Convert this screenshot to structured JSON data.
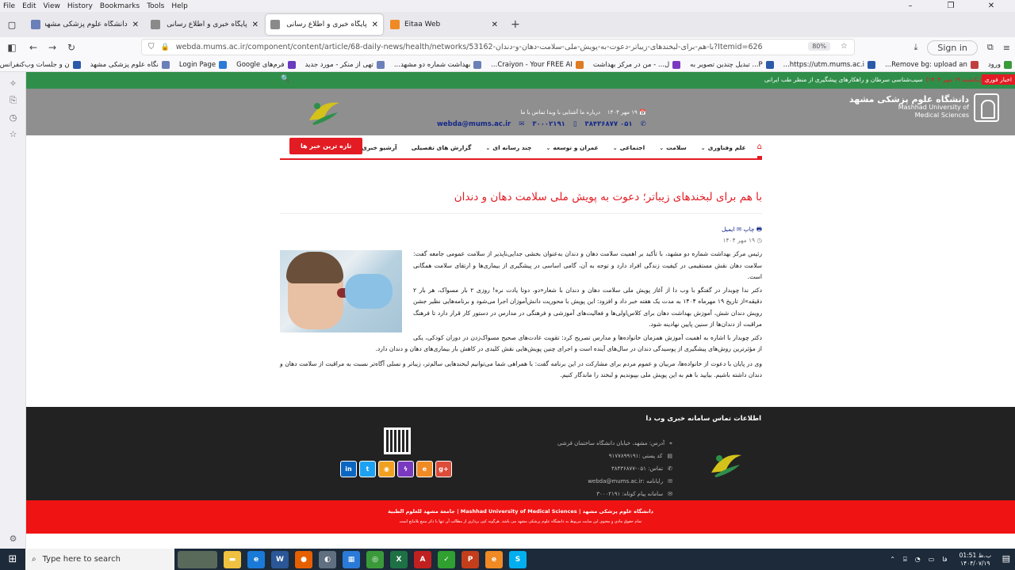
{
  "menubar": {
    "items": [
      "File",
      "Edit",
      "View",
      "History",
      "Bookmarks",
      "Tools",
      "Help"
    ]
  },
  "tabs": [
    {
      "label": "دانشگاه علوم پزشکی مشهد - دا...",
      "color": "#6b7fb8",
      "active": false
    },
    {
      "label": "پایگاه خبری و اطلاع رسانی وبدا دا...",
      "color": "#8a8a8a",
      "active": false
    },
    {
      "label": "پایگاه خبری و اطلاع رسانی وب دا...",
      "color": "#8a8a8a",
      "active": true
    },
    {
      "label": "Eitaa Web",
      "color": "#f08a24",
      "active": false
    }
  ],
  "address": {
    "url": "webda.mums.ac.ir/component/content/article/68-daily-news/health/networks/53162-با-هم-برای-لبخندهای-زیباتر-دعوت-به-پویش-ملی-سلامت-دهان-و-دندان?Itemid=626",
    "zoom": "80%",
    "signin": "Sign in"
  },
  "bookmarks": [
    {
      "label": "ورود",
      "color": "#3a9a3a"
    },
    {
      "label": "Remove bg: upload an...",
      "color": "#c04040"
    },
    {
      "label": "https://utm.mums.ac.i...",
      "color": "#2a5aa8"
    },
    {
      "label": "P... تبدیل چندین تصویر به",
      "color": "#2a5aa8"
    },
    {
      "label": "ل... - من در مرکز بهداشت",
      "color": "#7a3ac0"
    },
    {
      "label": "Craiyon - Your FREE AI...",
      "color": "#e07a20"
    },
    {
      "label": "بهداشت شماره دو مشهد...",
      "color": "#6b7fb8"
    },
    {
      "label": "تهی از منکر - مورد جدید",
      "color": "#6b7fb8"
    },
    {
      "label": "فرم‌های Google",
      "color": "#6a3ac0"
    },
    {
      "label": "Login Page",
      "color": "#2a7ad8"
    },
    {
      "label": "نگاه علوم پزشکی مشهد",
      "color": "#6b7fb8"
    },
    {
      "label": "ن و جلسات وب‌کنفرانس",
      "color": "#2a5aa8"
    }
  ],
  "newsbar": {
    "tag": "اخبار فوری",
    "ticker_date": "(یکشنبه ۱۹ مهر ۱۴۰۴)",
    "ticker": "سیب‌شناسی سرطان و راهکارهای پیشگیری از منظر طب ایرانی"
  },
  "header": {
    "uni_fa": "دانشگاه علوم پزشکی مشهد",
    "uni_en1": "Mashhad University of",
    "uni_en2": "Medical Sciences",
    "date": "۱۹ مهر ۱۴۰۴",
    "links": "درباره ما   آشنایی با وبدا   تماس با ما",
    "phone": "۰۵۱ ۳۸۴۳۶۸۷۷",
    "sms": "۳۰۰۰۲۱۹۱",
    "email": "webda@mums.ac.ir"
  },
  "nav": {
    "items": [
      "علم وفناوری",
      "سلامت",
      "اجتماعی",
      "عمران و توسعه",
      "چند رسانه ای",
      "گزارش های تفصیلی",
      "آرشیو خبری"
    ],
    "news_button": "تازه ترین خبر ها"
  },
  "article": {
    "title": "با هم برای لبخندهای زیباتر؛ دعوت به پویش ملی سلامت دهان و دندان",
    "print": "چاپ",
    "email": "ایمیل",
    "date": "۱۹ مهر ۱۴۰۴",
    "p1": "رئیس مرکز بهداشت شماره دو مشهد، با تأکید بر اهمیت سلامت دهان و دندان به‌عنوان بخشی جدایی‌ناپذیر از سلامت عمومی جامعه گفت: سلامت دهان نقش مستقیمی در کیفیت زندگی افراد دارد و توجه به آن، گامی اساسی در پیشگیری از بیماری‌ها و ارتقای سلامت همگانی است.",
    "p2": "دکتر ندا چوبدار در گفتگو با وب دا از آغاز پویش ملی سلامت دهان و دندان با شعار«دو، دوتا یادت نره! روزی ۲ بار مسواک، هر بار ۲ دقیقه»از تاریخ ۱۹ مهرماه ۱۴۰۴ به مدت یک هفته خبر داد و افزود: این پویش با محوریت دانش‌آموزان اجرا می‌شود و برنامه‌هایی نظیر جشن رویش دندان شش، آموزش بهداشت دهان برای کلاس‌اولی‌ها و فعالیت‌های آموزشی و فرهنگی در مدارس در دستور کار قرار دارد تا فرهنگ مراقبت از دندان‌ها از سنین پایین نهادینه شود.",
    "p3": "دکتر چوبدار با اشاره به اهمیت آموزش همزمان خانواده‌ها و مدارس تصریح کرد: تقویت عادت‌های صحیح مسواک‌زدن در دوران کودکی، یکی از مؤثرترین روش‌های پیشگیری از پوسیدگی دندان در سال‌های آینده است و اجرای چنین پویش‌هایی نقش کلیدی در کاهش بار بیماری‌های دهان و دندان دارد.",
    "p4": "وی در پایان با دعوت از خانواده‌ها، مربیان و عموم مردم برای مشارکت در این برنامه گفت: با همراهی شما می‌توانیم لبخندهایی سالم‌تر، زیباتر و نسلی آگاه‌تر نسبت به مراقبت از سلامت دهان و دندان داشته باشیم. بیایید با هم به این پویش ملی بپیوندیم و لبخند را ماندگار کنیم."
  },
  "footer": {
    "title": "اطلاعات تماس سامانه خبری وب دا",
    "address": "آدرس: مشهد، خیابان دانشگاه ساختمان قرشی",
    "postal": "کد پستی :۹۱۷۷۸۹۹۱۹۱",
    "phone": "تماس: ۰۵۱-۳۸۴۳۶۸۷۷",
    "email": "رایانامه :webda@mums.ac.ir",
    "sms": "سامانه پیام کوتاه: ۳۰۰۰۲۱۹۱",
    "social": [
      "in",
      "t",
      "◉",
      "ϟ",
      "e",
      "g+"
    ]
  },
  "redfooter": {
    "line1": "دانشگاه علوم پزشکی مشهد | Mashhad University of Medical Sciences | جامعة مشهد للعلوم الطبية",
    "line2": "تمام حقوق مادی و معنوی این سایت مربوط به دانشگاه علوم پزشکی مشهد می باشد. هرگونه کپی برداری از مطالب آن تنها با ذکر منبع بلامانع است"
  },
  "taskbar": {
    "search": "Type here to search",
    "time": "ب.ظ 01:51",
    "date": "۱۴۰۴/۰۷/۱۹",
    "lang": "فا"
  }
}
